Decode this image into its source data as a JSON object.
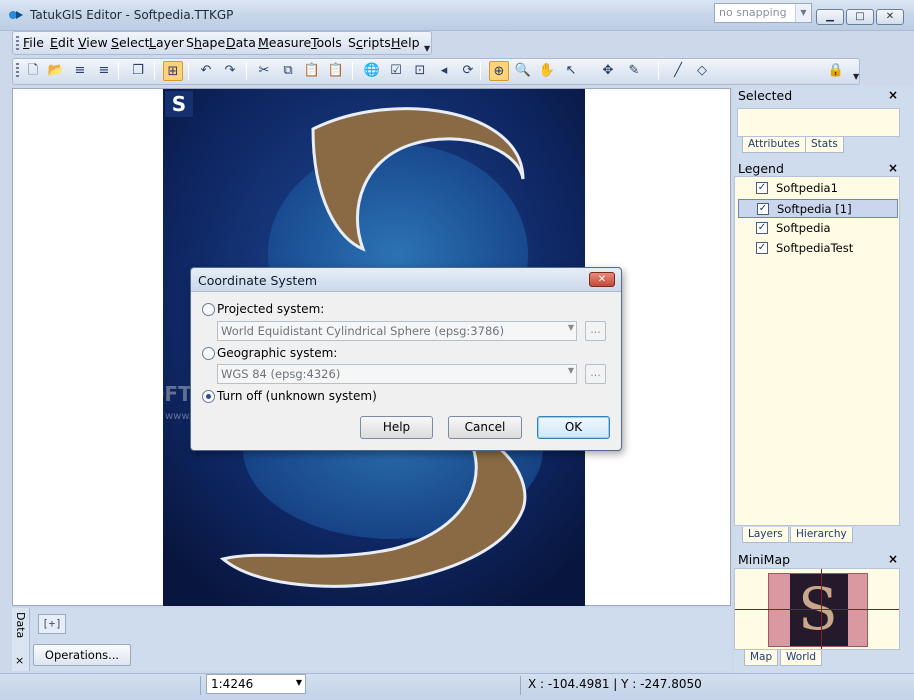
{
  "window": {
    "title": "TatukGIS Editor - Softpedia.TTKGP",
    "min": "▁",
    "max": "□",
    "close": "✕"
  },
  "menu": [
    {
      "pre": "",
      "u": "F",
      "post": "ile"
    },
    {
      "pre": "",
      "u": "E",
      "post": "dit"
    },
    {
      "pre": "",
      "u": "V",
      "post": "iew"
    },
    {
      "pre": "",
      "u": "S",
      "post": "elect"
    },
    {
      "pre": "",
      "u": "L",
      "post": "ayer"
    },
    {
      "pre": "S",
      "u": "h",
      "post": "ape"
    },
    {
      "pre": "",
      "u": "D",
      "post": "ata"
    },
    {
      "pre": "",
      "u": "M",
      "post": "easure"
    },
    {
      "pre": "",
      "u": "T",
      "post": "ools"
    },
    {
      "pre": "S",
      "u": "c",
      "post": "ripts"
    },
    {
      "pre": "",
      "u": "H",
      "post": "elp"
    }
  ],
  "toolbar": {
    "icons": [
      "new-file-icon",
      "open-icon",
      "add-layer-icon",
      "remove-layer-icon",
      "save-icon",
      "layer-props-icon",
      "undo-icon",
      "redo-icon",
      "cut-icon",
      "copy-icon",
      "paste-icon",
      "paste-special-icon",
      "globe-icon",
      "edit-icon",
      "extent-icon",
      "back-icon",
      "refresh-icon",
      "select-zoom-icon",
      "zoom-icon",
      "pan-icon",
      "select-arrow-icon",
      "vertex-icon",
      "draw-icon",
      "line-icon",
      "shape-icon"
    ],
    "glyphs": [
      "🗋",
      "📂",
      "≡",
      "≡",
      "❐",
      "⊞",
      "↶",
      "↷",
      "✂",
      "⧉",
      "📋",
      "📋",
      "🌐",
      "☑",
      "⊡",
      "◂",
      "⟳",
      "⊕",
      "🔍",
      "✋",
      "↖",
      "✥",
      "✎",
      "╱",
      "◇"
    ],
    "snapping": "no snapping",
    "lock_glyph": "🔒"
  },
  "map": {
    "logo": "S",
    "watermark": "SOFTPEDIA",
    "watermark_url": "www.softpedia.com"
  },
  "dialog": {
    "title": "Coordinate System",
    "close": "✕",
    "projected_label": "Projected system:",
    "projected_value": "World Equidistant Cylindrical Sphere  (epsg:3786)",
    "geographic_label": "Geographic system:",
    "geographic_value": "WGS 84  (epsg:4326)",
    "turnoff_label": "Turn off (unknown system)",
    "dots": "...",
    "selected_option": "turn_off",
    "help": "Help",
    "cancel": "Cancel",
    "ok": "OK"
  },
  "bottom": {
    "tab_label": "Data",
    "close": "×",
    "plus_tab": "[+]",
    "operations": "Operations..."
  },
  "status": {
    "scale": "1:4246",
    "coords": "X : -104.4981 | Y : -247.8050"
  },
  "panels": {
    "selected": {
      "title": "Selected",
      "close": "×",
      "tabs": [
        "Attributes",
        "Stats"
      ]
    },
    "legend": {
      "title": "Legend",
      "close": "×",
      "items": [
        {
          "label": "Softpedia1",
          "checked": true,
          "selected": false
        },
        {
          "label": "Softpedia [1]",
          "checked": true,
          "selected": true
        },
        {
          "label": "Softpedia",
          "checked": true,
          "selected": false
        },
        {
          "label": "SoftpediaTest",
          "checked": true,
          "selected": false
        }
      ],
      "tabs": [
        "Layers",
        "Hierarchy"
      ]
    },
    "minimap": {
      "title": "MiniMap",
      "close": "×",
      "tabs": [
        "Map",
        "World"
      ]
    }
  },
  "check_glyph": "✓",
  "dropdown_glyph": "▼"
}
